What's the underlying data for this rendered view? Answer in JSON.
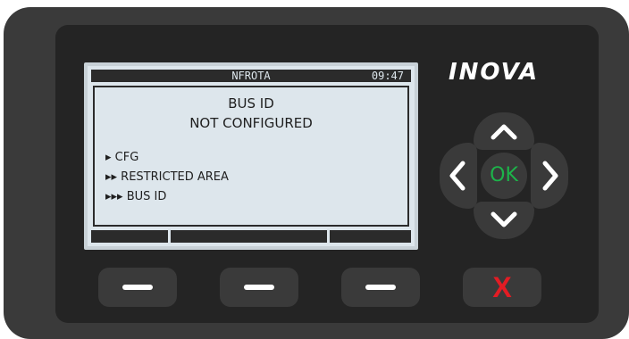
{
  "brand": {
    "logo": "INOVA"
  },
  "lcd": {
    "title": "NFROTA",
    "time": "09:47",
    "message": [
      "BUS ID",
      "NOT CONFIGURED"
    ],
    "menu_path": [
      "▸ CFG",
      "▸▸ RESTRICTED AREA",
      "▸▸▸ BUS ID"
    ]
  },
  "keypad": {
    "ok_label": "OK",
    "cancel_label": "X"
  },
  "colors": {
    "ok_green": "#1db34a",
    "cancel_red": "#e31c24",
    "lcd_background": "#dde6ec",
    "device_body": "#3a3a3a"
  },
  "icons": {
    "up": "chevron-up-icon",
    "down": "chevron-down-icon",
    "left": "chevron-left-icon",
    "right": "chevron-right-icon",
    "softkey": "dash-icon"
  }
}
